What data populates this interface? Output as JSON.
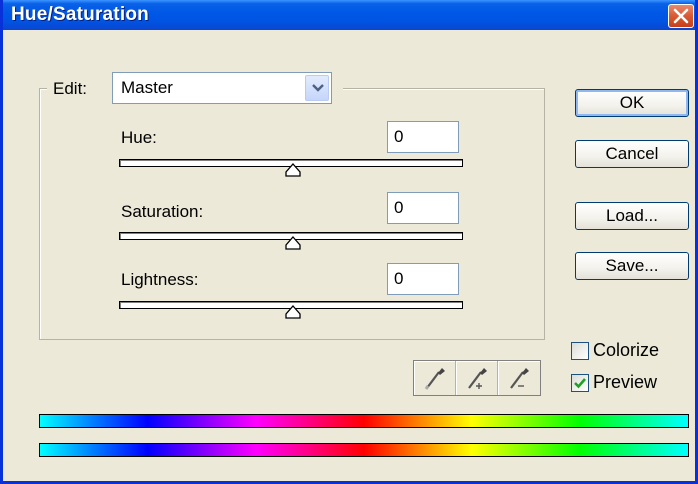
{
  "window": {
    "title": "Hue/Saturation"
  },
  "edit": {
    "label": "Edit:",
    "selected": "Master"
  },
  "sliders": [
    {
      "label": "Hue:",
      "value": "0",
      "position": 0.5
    },
    {
      "label": "Saturation:",
      "value": "0",
      "position": 0.5
    },
    {
      "label": "Lightness:",
      "value": "0",
      "position": 0.5
    }
  ],
  "buttons": {
    "ok": "OK",
    "cancel": "Cancel",
    "load": "Load...",
    "save": "Save..."
  },
  "options": {
    "colorize": {
      "label": "Colorize",
      "checked": false
    },
    "preview": {
      "label": "Preview",
      "checked": true
    }
  },
  "icons": {
    "close": "close-icon",
    "dropdown": "chevron-down-icon",
    "eyedropper": "eyedropper-icon",
    "eyedropper_plus": "eyedropper-plus-icon",
    "eyedropper_minus": "eyedropper-minus-icon"
  },
  "colors": {
    "titlebar": "#0054e3",
    "dialog_bg": "#ece9d8",
    "close_button": "#d95a32",
    "check_mark": "#21a121"
  }
}
